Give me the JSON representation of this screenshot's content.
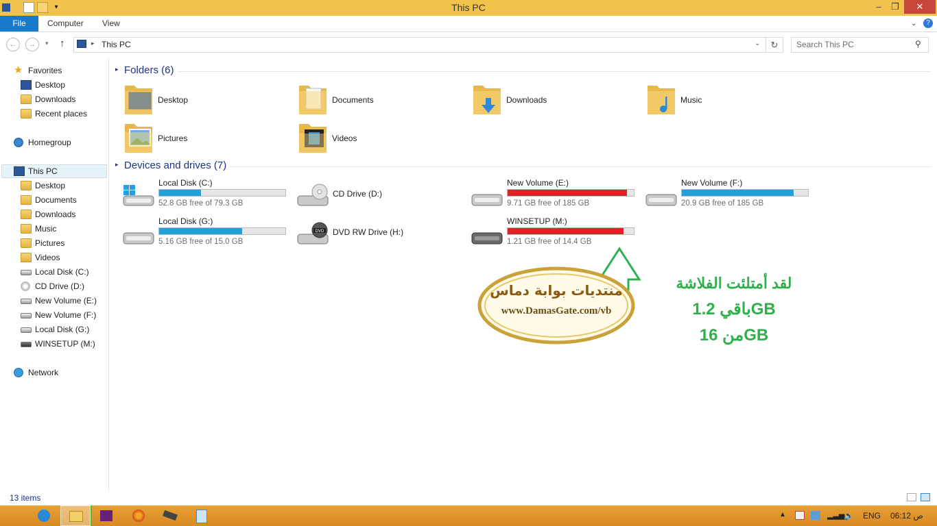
{
  "window": {
    "title": "This PC"
  },
  "ribbon": {
    "tabs": [
      "File",
      "Computer",
      "View"
    ]
  },
  "address": {
    "crumb": "This PC",
    "search_placeholder": "Search This PC"
  },
  "nav": {
    "favorites": "Favorites",
    "fav_items": [
      "Desktop",
      "Downloads",
      "Recent places"
    ],
    "homegroup": "Homegroup",
    "thispc": "This PC",
    "pc_items": [
      "Desktop",
      "Documents",
      "Downloads",
      "Music",
      "Pictures",
      "Videos",
      "Local Disk (C:)",
      "CD Drive (D:)",
      "New Volume (E:)",
      "New Volume (F:)",
      "Local Disk (G:)",
      "WINSETUP (M:)"
    ],
    "network": "Network"
  },
  "main": {
    "folders_header": "Folders (6)",
    "folders": [
      "Desktop",
      "Documents",
      "Downloads",
      "Music",
      "Pictures",
      "Videos"
    ],
    "drives_header": "Devices and drives (7)",
    "drives": [
      {
        "name": "Local Disk (C:)",
        "free": "52.8 GB free of 79.3 GB",
        "used_fraction": 0.334,
        "color": "#26a0da"
      },
      {
        "name": "CD Drive (D:)"
      },
      {
        "name": "New Volume (E:)",
        "free": "9.71 GB free of 185 GB",
        "used_fraction": 0.948,
        "color": "#da2626"
      },
      {
        "name": "New Volume (F:)",
        "free": "20.9 GB free of 185 GB",
        "used_fraction": 0.887,
        "color": "#26a0da"
      },
      {
        "name": "Local Disk (G:)",
        "free": "5.16 GB free of 15.0 GB",
        "used_fraction": 0.656,
        "color": "#26a0da"
      },
      {
        "name": "DVD RW Drive (H:)"
      },
      {
        "name": "WINSETUP (M:)",
        "free": "1.21 GB free of 14.4 GB",
        "used_fraction": 0.916,
        "color": "#da2626"
      }
    ]
  },
  "status": {
    "items": "13 items"
  },
  "taskbar": {
    "lang": "ENG",
    "clock": "06:12 ص"
  },
  "overlay": {
    "logo_arabic": "منتديات بوابة دماس",
    "logo_url": "www.DamasGate.com/vb",
    "arabic_line1": "لقد أمتلئت الفلاشة",
    "arabic_line2": "باقي 1.2GB",
    "arabic_line3": "من 16GB"
  },
  "colors": {
    "titlebar": "#f1c34a",
    "accent": "#1979ca",
    "bar_normal": "#26a0da",
    "bar_full": "#da2626",
    "annotation": "#2fb04d"
  }
}
